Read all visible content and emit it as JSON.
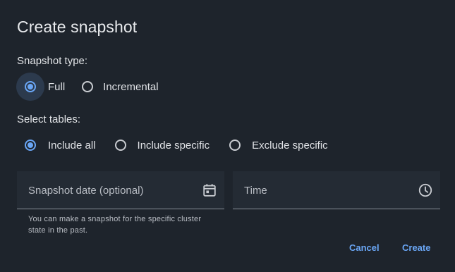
{
  "dialog": {
    "title": "Create snapshot",
    "snapshot_type": {
      "label": "Snapshot type:",
      "options": [
        {
          "label": "Full",
          "checked": true
        },
        {
          "label": "Incremental",
          "checked": false
        }
      ]
    },
    "select_tables": {
      "label": "Select tables:",
      "options": [
        {
          "label": "Include all",
          "checked": true
        },
        {
          "label": "Include specific",
          "checked": false
        },
        {
          "label": "Exclude specific",
          "checked": false
        }
      ]
    },
    "date_field": {
      "label": "Snapshot date (optional)",
      "icon": "calendar-icon",
      "hint": "You can make a snapshot for the specific cluster state in the past."
    },
    "time_field": {
      "label": "Time",
      "icon": "clock-icon"
    },
    "actions": {
      "cancel": "Cancel",
      "create": "Create"
    }
  },
  "colors": {
    "background": "#1e242c",
    "accent": "#6aa6f5",
    "field_background": "#242b34"
  }
}
